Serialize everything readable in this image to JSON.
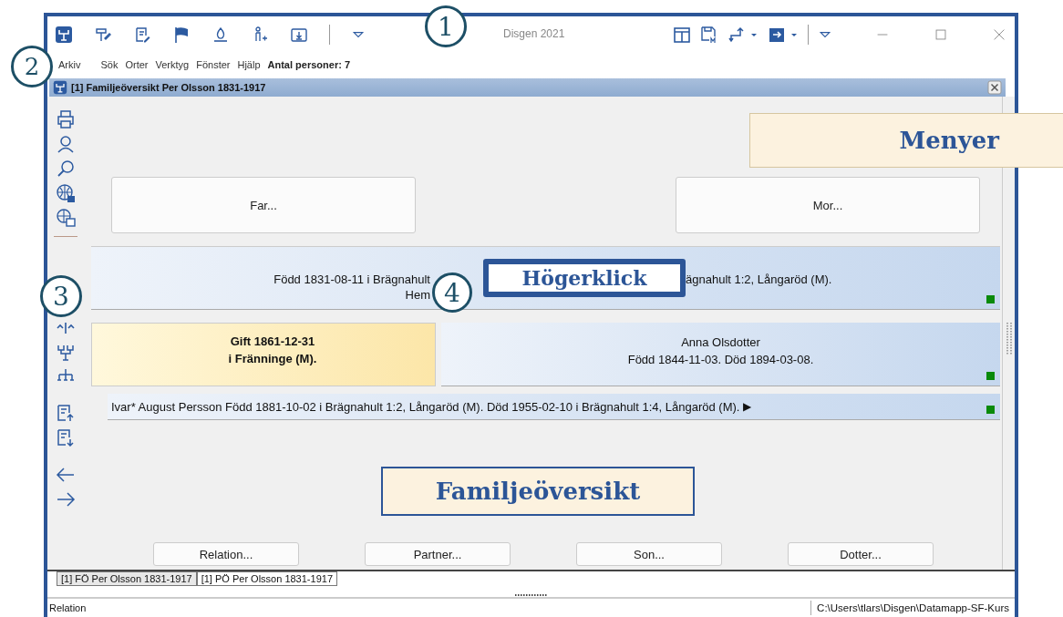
{
  "window": {
    "title": "Disgen 2021"
  },
  "menu": [
    {
      "label": "Arkiv"
    },
    {
      "label": "Sök"
    },
    {
      "label": "Orter"
    },
    {
      "label": "Verktyg"
    },
    {
      "label": "Fönster"
    },
    {
      "label": "Hjälp"
    }
  ],
  "menu_info": "Antal personer: 7",
  "child_window": {
    "title": "[1] Familjeöversikt Per Olsson 1831-1917"
  },
  "family": {
    "father_button": "Far...",
    "mother_button": "Mor...",
    "person": {
      "line_left": "Född 1831-08-11 i Brägnahult",
      "line_right": "ägnahult 1:2, Långaröd (M).",
      "line_3": "Hem"
    },
    "marriage": [
      "Gift 1861-12-31",
      "i Fränninge (M)."
    ],
    "partner": {
      "name": "Anna Olsdotter",
      "details": "Född 1844-11-03. Död 1894-03-08."
    },
    "children": [
      {
        "text": "Ivar* August Persson Född 1881-10-02 i Brägnahult 1:2, Långaröd (M). Död 1955-02-10 i Brägnahult 1:4, Långaröd (M).",
        "arrow": "▶"
      }
    ]
  },
  "actions": [
    "Relation...",
    "Partner...",
    "Son...",
    "Dotter..."
  ],
  "window_tabs": [
    {
      "label": "[1] FÖ Per Olsson 1831-1917",
      "selected": true
    },
    {
      "label": "[1] PÖ Per Olsson 1831-1917",
      "selected": false
    }
  ],
  "status_bar": {
    "text": "Relation",
    "path": "C:\\Users\\tlars\\Disgen\\Datamapp-SF-Kurs"
  },
  "annotations": {
    "markers": [
      "1",
      "2",
      "3",
      "4"
    ],
    "labels": [
      "Menyer",
      "Högerklick",
      "Familjeöversikt"
    ]
  }
}
